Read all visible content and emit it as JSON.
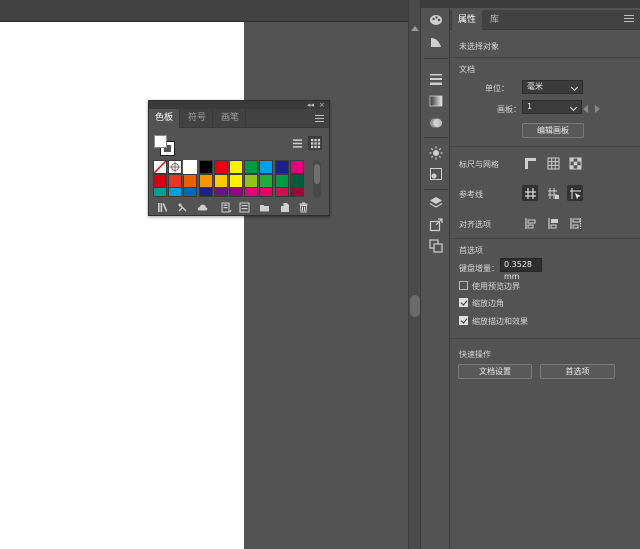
{
  "properties_panel": {
    "tabs": [
      {
        "label": "属性",
        "active": true
      },
      {
        "label": "库",
        "active": false
      }
    ],
    "selection_status": "未选择对象",
    "document": {
      "title": "文档",
      "units_label": "单位：",
      "units_value": "毫米",
      "artboard_label": "画板：",
      "artboard_value": "1",
      "edit_artboards_button": "编辑画板"
    },
    "rulers_grids_label": "标尺与网格",
    "guides_label": "参考线",
    "align_options_label": "对齐选项",
    "preferences": {
      "title": "首选项",
      "keyboard_increment_label": "键盘增量：",
      "keyboard_increment_value": "0.3528 mm",
      "checkboxes": [
        {
          "label": "使用预览边界",
          "checked": false
        },
        {
          "label": "缩放边角",
          "checked": true
        },
        {
          "label": "缩放描边和效果",
          "checked": true
        }
      ]
    },
    "quick_actions": {
      "title": "快速操作",
      "document_setup_button": "文档设置",
      "preferences_button": "首选项"
    }
  },
  "swatches_panel": {
    "tabs": [
      {
        "label": "色板",
        "active": true
      },
      {
        "label": "符号",
        "active": false
      },
      {
        "label": "画笔",
        "active": false
      }
    ],
    "swatch_rows": [
      [
        "none",
        "registration",
        "#ffffff",
        "#000000",
        "#e60012",
        "#fff100",
        "#009944",
        "#00a0e9",
        "#1d2088",
        "#e4007f"
      ],
      [
        "#d7000f",
        "#e83820",
        "#eb6100",
        "#f39800",
        "#fcc800",
        "#fff100",
        "#8fc31f",
        "#22ac38",
        "#009944",
        "#005e3c"
      ],
      [
        "#009e96",
        "#00a0e9",
        "#0068b7",
        "#1d2088",
        "#601986",
        "#920783",
        "#e4007f",
        "#e5006a",
        "#d0104c",
        "#a40035"
      ]
    ]
  },
  "colors": {
    "ui_background": "#535353",
    "panel_header": "#424242",
    "artboard": "#ffffff"
  }
}
